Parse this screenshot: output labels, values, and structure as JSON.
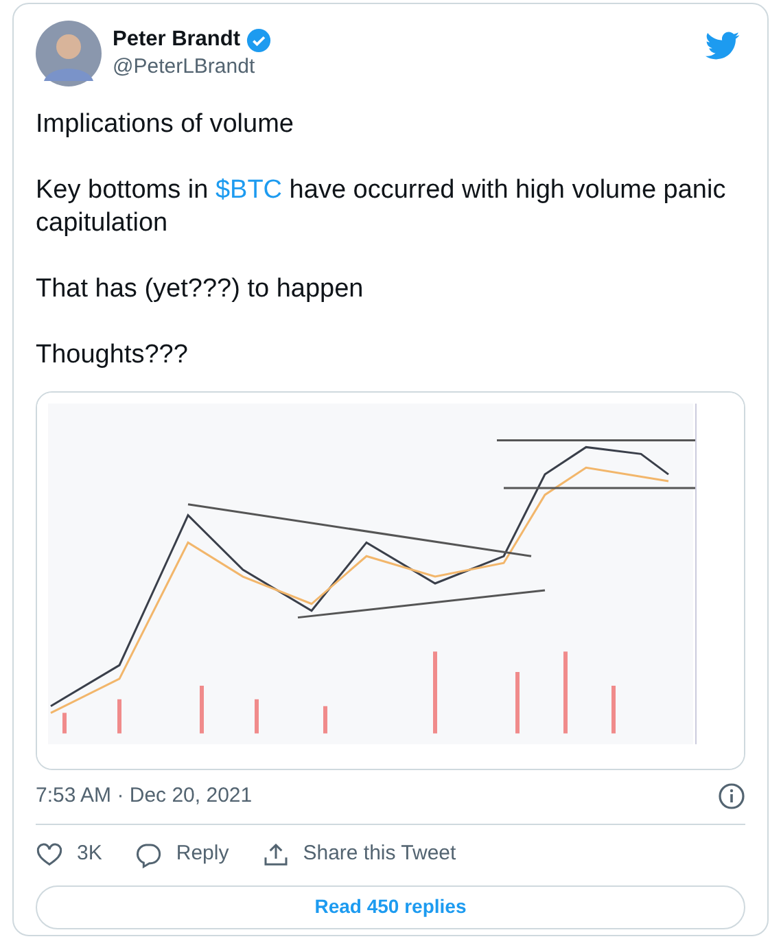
{
  "author": {
    "name": "Peter Brandt",
    "verified": true,
    "handle": "@PeterLBrandt"
  },
  "paragraphs": [
    [
      {
        "kind": "text",
        "text": "Implications of volume"
      }
    ],
    [
      {
        "kind": "text",
        "text": "Key bottoms in "
      },
      {
        "kind": "link",
        "text": "$BTC"
      },
      {
        "kind": "text",
        "text": " have occurred with high volume panic capitulation"
      }
    ],
    [
      {
        "kind": "text",
        "text": "That has (yet???) to happen"
      }
    ],
    [
      {
        "kind": "text",
        "text": "Thoughts???"
      }
    ]
  ],
  "media": {
    "kind": "picture"
  },
  "timestamp": "7:53 AM · Dec 20, 2021",
  "actions": [
    {
      "kind": "like",
      "label": "3K"
    },
    {
      "kind": "reply",
      "label": "Reply"
    },
    {
      "kind": "share",
      "label": "Share this Tweet"
    }
  ],
  "read_button": "Read 450 replies"
}
